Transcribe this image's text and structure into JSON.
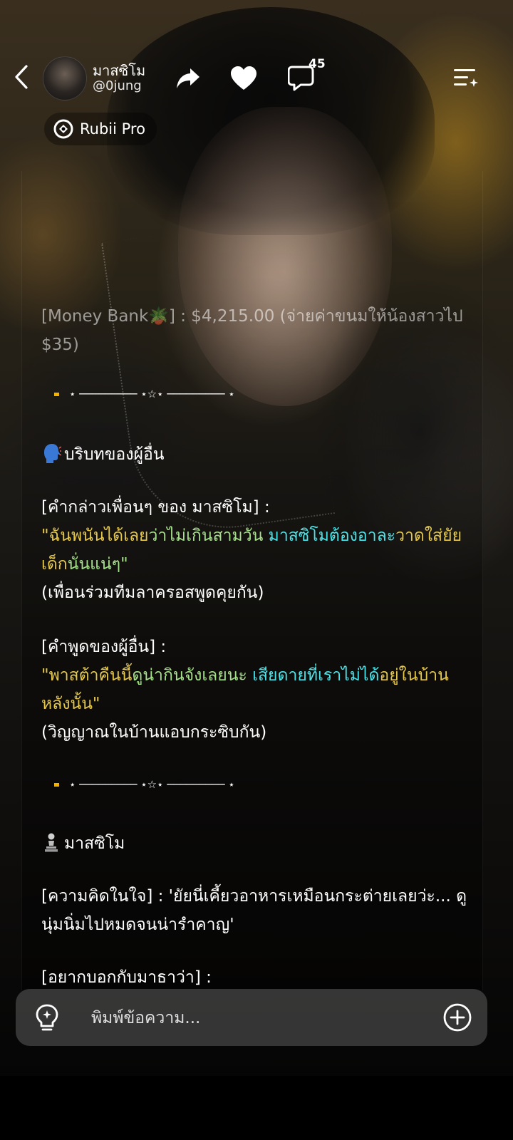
{
  "header": {
    "back_icon": "chevron-left-icon",
    "character_name": "มาสซิโม",
    "handle": "@0jung",
    "share_icon": "share-arrow-icon",
    "like_icon": "heart-icon",
    "comment_icon": "comment-bubble-icon",
    "comment_count": "45",
    "menu_icon": "list-sparkle-icon"
  },
  "badge": {
    "icon": "rubii-logo-icon",
    "label": "Rubii Pro"
  },
  "message": {
    "money_line": "[Money Bank🪴] : $4,215.00 (จ่ายค่าขนมให้น้องสาวไป $35)",
    "divider": "⋆ ───────── ⋆☆⋆ ───────── ⋆",
    "others_heading": "บริบทของผู้อื่น",
    "others_heading_icon": "speaking-head-icon",
    "friends_label": "[คำกล่าวเพื่อนๆ ของ มาสซิโม] :",
    "friends_quote": "\"ฉันพนันได้เลยว่าไม่เกินสามวัน มาสซิโมต้องอาละวาดใส่ยัยเด็กนั่นแน่ๆ\"",
    "friends_note": "(เพื่อนร่วมทีมลาครอสพูดคุยกัน)",
    "others_label": "[คำพูดของผู้อื่น] :",
    "others_quote": "\"พาสต้าคืนนี้ดูน่ากินจังเลยนะ เสียดายที่เราไม่ได้อยู่ในบ้านหลังนั้น\"",
    "others_note": "(วิญญาณในบ้านแอบกระซิบกัน)",
    "char_heading": "มาสซิโม",
    "char_heading_icon": "chess-pawn-icon",
    "thought": "[ความคิดในใจ] : 'ยัยนี่เคี้ยวอาหารเหมือนกระต่ายเลยว่ะ... ดูนุ่มนิ่มไปหมดจนน่ารำคาญ'",
    "want_to_say": "[อยากบอกกับมาธาว่า] :"
  },
  "input": {
    "placeholder": "พิมพ์ข้อความ...",
    "left_icon": "lightbulb-icon",
    "right_icon": "plus-circle-icon"
  },
  "colors": {
    "quote_yellow": "#e5c84a",
    "quote_green": "#a6e08a",
    "quote_cyan": "#49e4e9",
    "divider_dot": "#f0b400"
  }
}
